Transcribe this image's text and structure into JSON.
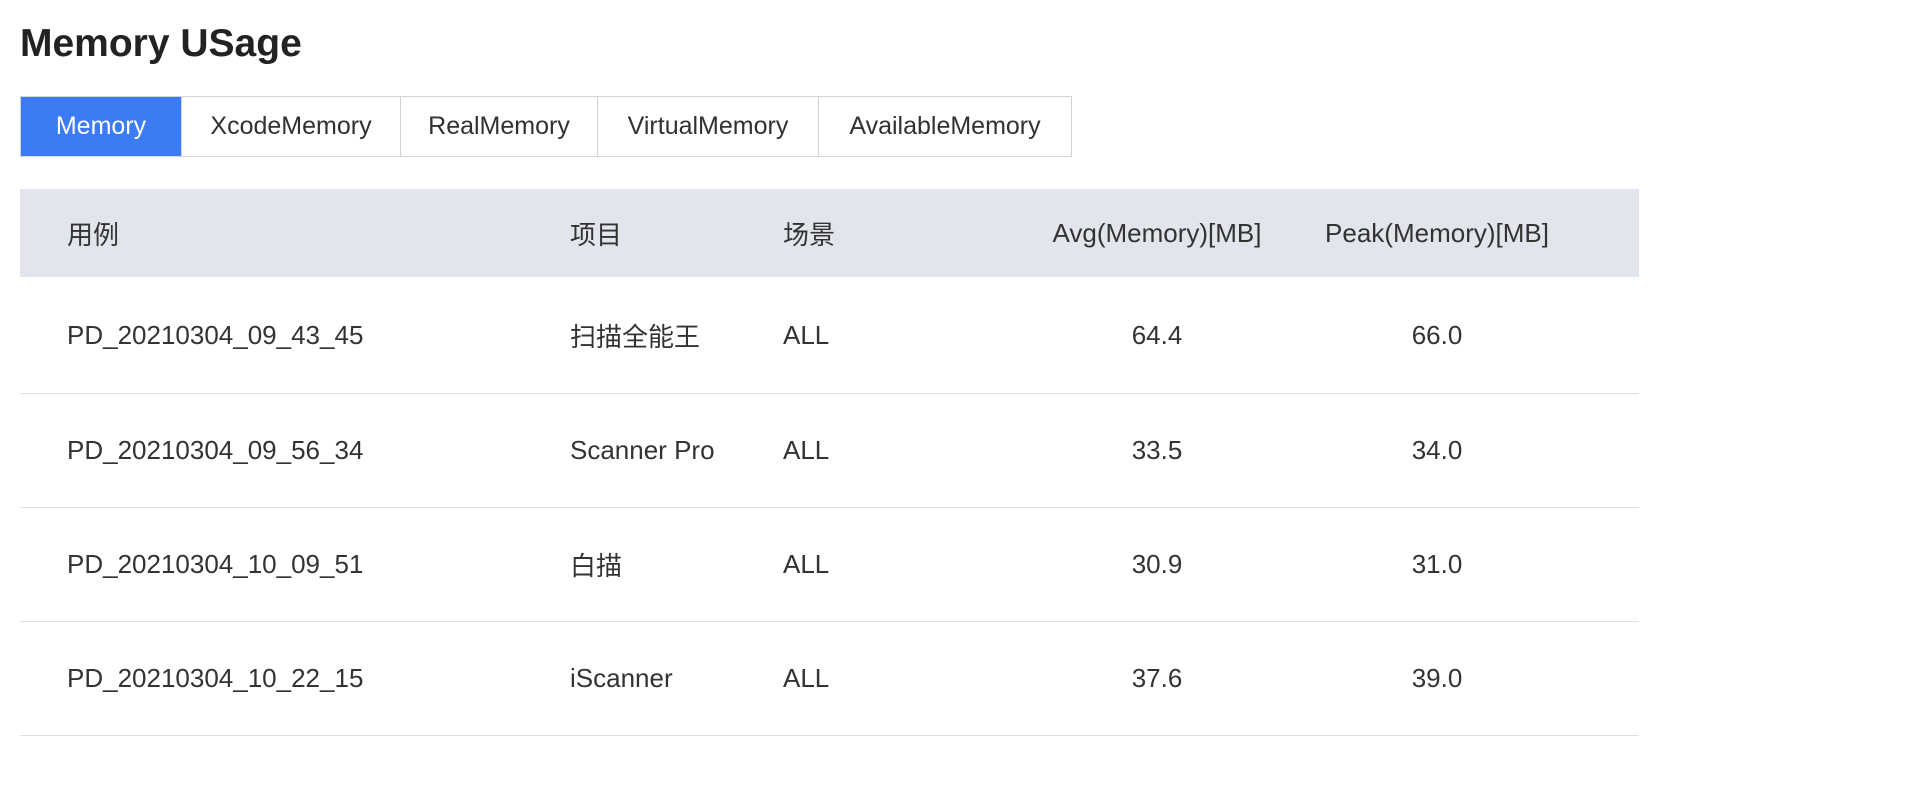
{
  "page": {
    "title": "Memory USage"
  },
  "tabs": [
    {
      "label": "Memory",
      "active": true
    },
    {
      "label": "XcodeMemory",
      "active": false
    },
    {
      "label": "RealMemory",
      "active": false
    },
    {
      "label": "VirtualMemory",
      "active": false
    },
    {
      "label": "AvailableMemory",
      "active": false
    }
  ],
  "table": {
    "columns": [
      "用例",
      "项目",
      "场景",
      "Avg(Memory)[MB]",
      "Peak(Memory)[MB]"
    ],
    "rows": [
      [
        "PD_20210304_09_43_45",
        "扫描全能王",
        "ALL",
        "64.4",
        "66.0"
      ],
      [
        "PD_20210304_09_56_34",
        "Scanner Pro",
        "ALL",
        "33.5",
        "34.0"
      ],
      [
        "PD_20210304_10_09_51",
        "白描",
        "ALL",
        "30.9",
        "31.0"
      ],
      [
        "PD_20210304_10_22_15",
        "iScanner",
        "ALL",
        "37.6",
        "39.0"
      ]
    ]
  },
  "colors": {
    "active_tab": "#3b7cf5",
    "header_bg": "#e2e5ec",
    "border": "#dcdfe6"
  }
}
